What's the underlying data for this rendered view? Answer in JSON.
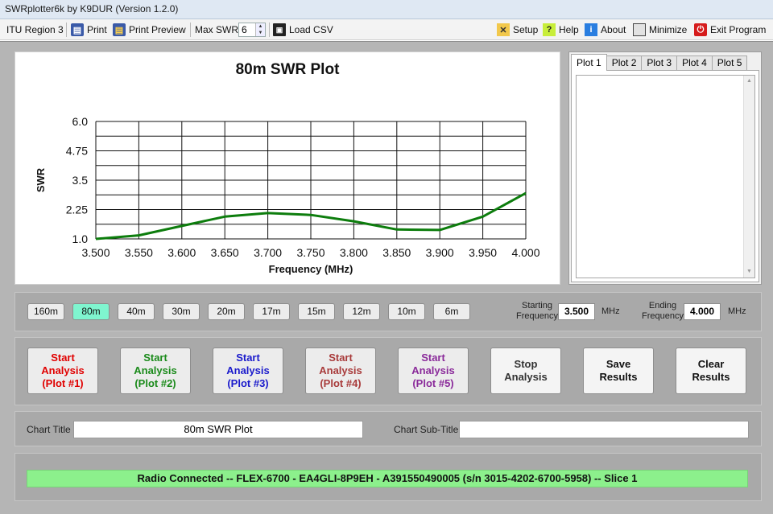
{
  "window": {
    "title": "SWRplotter6k by K9DUR (Version 1.2.0)"
  },
  "toolbar": {
    "region": "ITU Region 3",
    "print": "Print",
    "print_preview": "Print Preview",
    "max_swr_label": "Max SWR",
    "max_swr_value": "6",
    "load_csv": "Load CSV",
    "setup": "Setup",
    "help": "Help",
    "about": "About",
    "minimize": "Minimize",
    "exit": "Exit Program"
  },
  "plot_tabs": [
    "Plot 1",
    "Plot 2",
    "Plot 3",
    "Plot 4",
    "Plot 5"
  ],
  "bands": [
    "160m",
    "80m",
    "40m",
    "30m",
    "20m",
    "17m",
    "15m",
    "12m",
    "10m",
    "6m"
  ],
  "selected_band": "80m",
  "frequency": {
    "start_label_1": "Starting",
    "start_label_2": "Frequency",
    "start_value": "3.500",
    "end_label_1": "Ending",
    "end_label_2": "Frequency",
    "end_value": "4.000",
    "unit": "MHz"
  },
  "actions": [
    {
      "line1": "Start",
      "line2": "Analysis",
      "line3": "(Plot #1)",
      "color": "#e00000"
    },
    {
      "line1": "Start",
      "line2": "Analysis",
      "line3": "(Plot #2)",
      "color": "#1a8a1a"
    },
    {
      "line1": "Start",
      "line2": "Analysis",
      "line3": "(Plot #3)",
      "color": "#1a1acc"
    },
    {
      "line1": "Start",
      "line2": "Analysis",
      "line3": "(Plot #4)",
      "color": "#a83a3a"
    },
    {
      "line1": "Start",
      "line2": "Analysis",
      "line3": "(Plot #5)",
      "color": "#8a2a9a"
    },
    {
      "line1": "Stop",
      "line2": "Analysis",
      "line3": "",
      "color": "#333333"
    },
    {
      "line1": "Save",
      "line2": "Results",
      "line3": "",
      "color": "#111111"
    },
    {
      "line1": "Clear",
      "line2": "Results",
      "line3": "",
      "color": "#111111"
    }
  ],
  "chart_title_section": {
    "title_label": "Chart Title",
    "title_value": "80m SWR Plot",
    "subtitle_label": "Chart Sub-Title",
    "subtitle_value": ""
  },
  "status": {
    "text": "Radio Connected -- FLEX-6700 - EA4GLI-8P9EH - A391550490005  (s/n 3015-4202-6700-5958) -- Slice 1"
  },
  "chart_data": {
    "type": "line",
    "title": "80m SWR Plot",
    "xlabel": "Frequency (MHz)",
    "ylabel": "SWR",
    "xlim": [
      3.5,
      4.0
    ],
    "ylim": [
      1.0,
      6.0
    ],
    "xticks": [
      "3.500",
      "3.550",
      "3.600",
      "3.650",
      "3.700",
      "3.750",
      "3.800",
      "3.850",
      "3.900",
      "3.950",
      "4.000"
    ],
    "yticks": [
      "1.0",
      "2.25",
      "3.5",
      "4.75",
      "6.0"
    ],
    "grid": true,
    "series_color": "#0d7d0d",
    "x": [
      3.5,
      3.55,
      3.6,
      3.65,
      3.7,
      3.75,
      3.8,
      3.85,
      3.9,
      3.95,
      4.0
    ],
    "y": [
      1.0,
      1.15,
      1.55,
      1.95,
      2.1,
      2.02,
      1.75,
      1.4,
      1.38,
      1.95,
      2.95
    ]
  },
  "colors": {
    "selected_band": "#7ff5cf",
    "status_bg": "#8cf08c",
    "panel_bg": "#a9a9a9"
  }
}
